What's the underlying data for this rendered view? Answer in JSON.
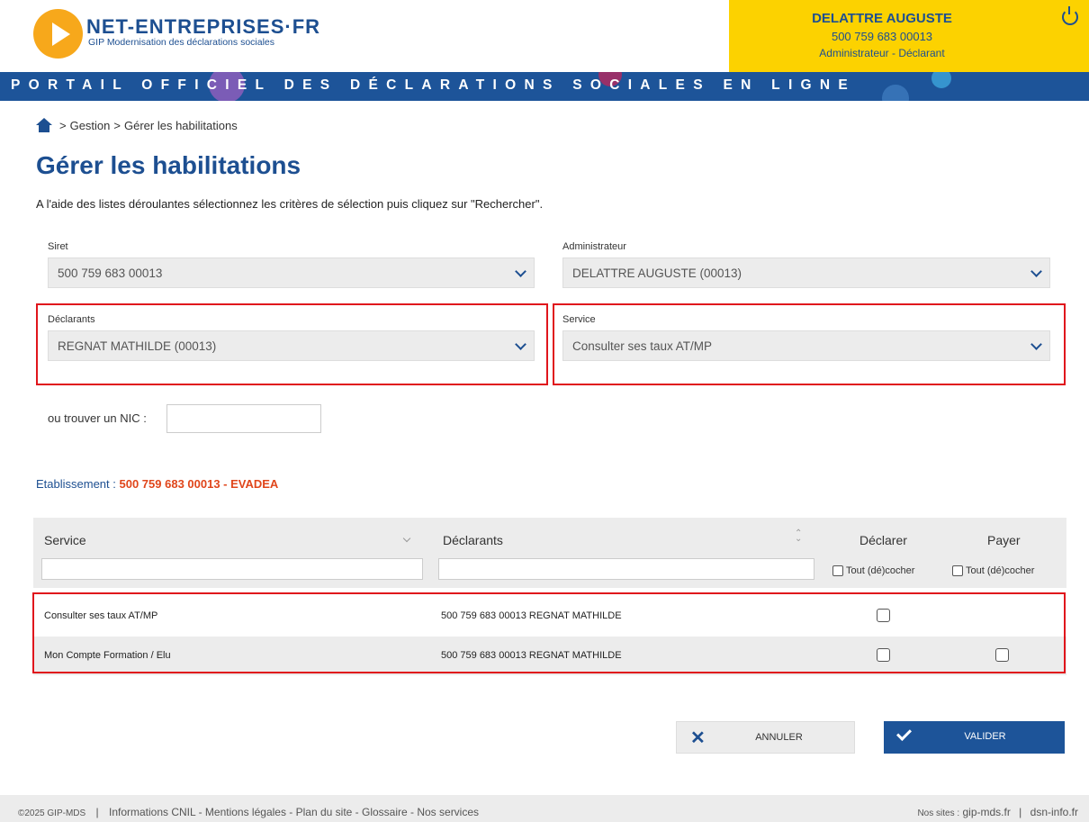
{
  "header": {
    "brand": "NET-ENTREPRISES·FR",
    "tagline": "GIP Modernisation des déclarations sociales",
    "banner": "PORTAIL OFFICIEL DES DÉCLARATIONS SOCIALES EN LIGNE",
    "user": {
      "name": "DELATTRE AUGUSTE",
      "siret": "500 759 683 00013",
      "role": "Administrateur - Déclarant"
    },
    "accent": "#1d5499",
    "user_bg": "#fcd200"
  },
  "breadcrumb": {
    "sep1": ">",
    "item1": "Gestion",
    "sep2": ">",
    "item2": "Gérer les habilitations"
  },
  "page": {
    "title": "Gérer les habilitations",
    "intro": "A l'aide des listes déroulantes sélectionnez les critères de sélection puis cliquez sur \"Rechercher\"."
  },
  "form": {
    "siret_label": "Siret",
    "siret_value": "500 759 683 00013",
    "admin_label": "Administrateur",
    "admin_value": "DELATTRE AUGUSTE (00013)",
    "declarants_label": "Déclarants",
    "declarants_value": "REGNAT MATHILDE (00013)",
    "service_label": "Service",
    "service_value": "Consulter ses taux AT/MP",
    "nic_label": "ou trouver un NIC :",
    "nic_value": ""
  },
  "etablissement": {
    "label": "Etablissement :",
    "value": "500 759 683 00013 - EVADEA"
  },
  "table": {
    "headers": {
      "service": "Service",
      "declarants": "Déclarants",
      "declarer": "Déclarer",
      "payer": "Payer"
    },
    "tout_decocher": "Tout (dé)cocher",
    "rows": [
      {
        "service": "Consulter ses taux AT/MP",
        "declarant": "500 759 683 00013 REGNAT MATHILDE"
      },
      {
        "service": "Mon Compte Formation / Elu",
        "declarant": "500 759 683 00013 REGNAT MATHILDE"
      }
    ]
  },
  "buttons": {
    "cancel": "ANNULER",
    "validate": "VALIDER"
  },
  "footer": {
    "copyright": "©2025 GIP-MDS",
    "divider": "|",
    "links": "Informations CNIL - Mentions légales - Plan du site - Glossaire - Nos services",
    "nos_sites_label": "Nos sites :",
    "site1": "gip-mds.fr",
    "site2": "dsn-info.fr"
  }
}
